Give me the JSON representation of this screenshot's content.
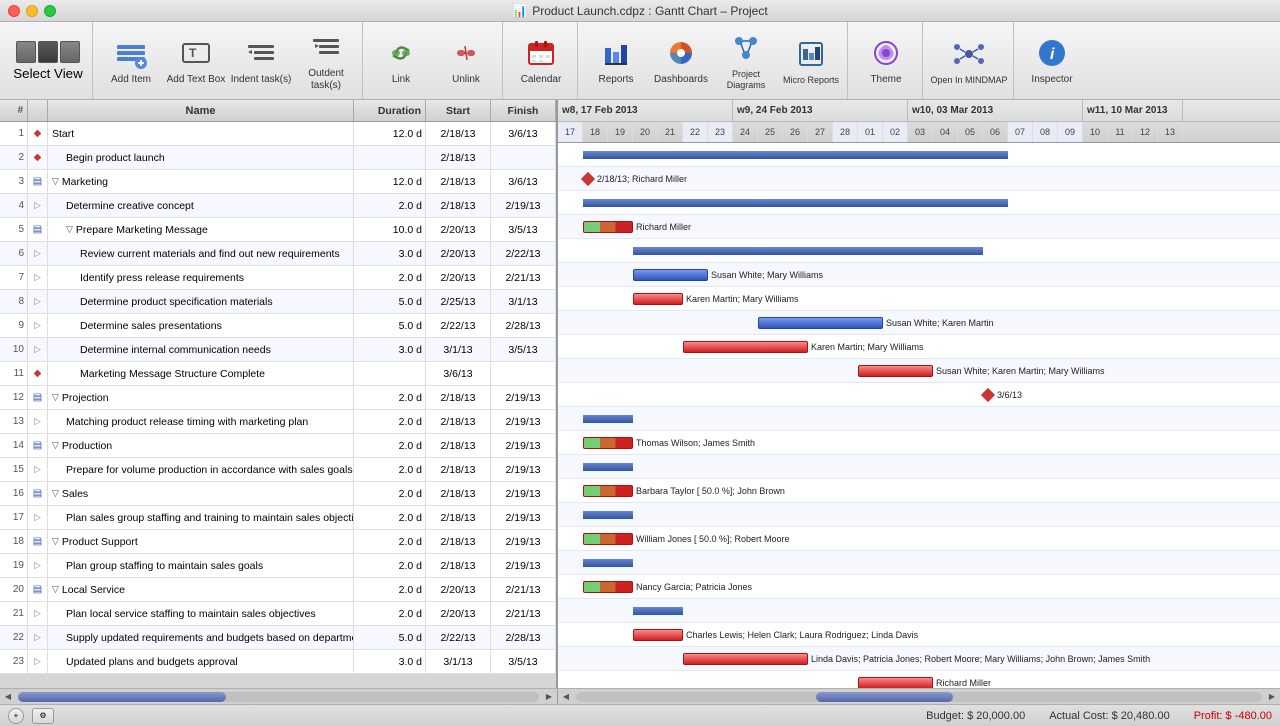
{
  "titlebar": {
    "title": "Product Launch.cdpz : Gantt Chart – Project"
  },
  "toolbar": {
    "select_view_label": "Select View",
    "add_item_label": "Add Item",
    "add_text_box_label": "Add Text Box",
    "indent_label": "Indent task(s)",
    "outdent_label": "Outdent task(s)",
    "link_label": "Link",
    "unlink_label": "Unlink",
    "calendar_label": "Calendar",
    "reports_label": "Reports",
    "dashboards_label": "Dashboards",
    "project_diagrams_label": "Project Diagrams",
    "micro_reports_label": "Micro Reports",
    "theme_label": "Theme",
    "open_in_mindmap_label": "Open In MINDMAP",
    "inspector_label": "Inspector"
  },
  "table": {
    "headers": [
      "#",
      "Name",
      "Duration",
      "Start",
      "Finish"
    ],
    "rows": [
      {
        "num": 1,
        "indent": 0,
        "name": "Start",
        "duration": "12.0 d",
        "start": "2/18/13",
        "finish": "3/6/13",
        "is_milestone": true
      },
      {
        "num": 2,
        "indent": 1,
        "name": "Begin product launch",
        "duration": "",
        "start": "2/18/13",
        "finish": "",
        "is_milestone": true
      },
      {
        "num": 3,
        "indent": 0,
        "name": "Marketing",
        "duration": "12.0 d",
        "start": "2/18/13",
        "finish": "3/6/13",
        "is_group": true
      },
      {
        "num": 4,
        "indent": 1,
        "name": "Determine creative concept",
        "duration": "2.0 d",
        "start": "2/18/13",
        "finish": "2/19/13"
      },
      {
        "num": 5,
        "indent": 1,
        "name": "Prepare Marketing Message",
        "duration": "10.0 d",
        "start": "2/20/13",
        "finish": "3/5/13",
        "is_group": true
      },
      {
        "num": 6,
        "indent": 2,
        "name": "Review current materials and find out new requirements",
        "duration": "3.0 d",
        "start": "2/20/13",
        "finish": "2/22/13"
      },
      {
        "num": 7,
        "indent": 2,
        "name": "Identify press release requirements",
        "duration": "2.0 d",
        "start": "2/20/13",
        "finish": "2/21/13"
      },
      {
        "num": 8,
        "indent": 2,
        "name": "Determine product specification materials",
        "duration": "5.0 d",
        "start": "2/25/13",
        "finish": "3/1/13"
      },
      {
        "num": 9,
        "indent": 2,
        "name": "Determine sales presentations",
        "duration": "5.0 d",
        "start": "2/22/13",
        "finish": "2/28/13"
      },
      {
        "num": 10,
        "indent": 2,
        "name": "Determine internal communication needs",
        "duration": "3.0 d",
        "start": "3/1/13",
        "finish": "3/5/13"
      },
      {
        "num": 11,
        "indent": 2,
        "name": "Marketing Message Structure Complete",
        "duration": "",
        "start": "3/6/13",
        "finish": "",
        "is_milestone": true
      },
      {
        "num": 12,
        "indent": 0,
        "name": "Projection",
        "duration": "2.0 d",
        "start": "2/18/13",
        "finish": "2/19/13",
        "is_group": true
      },
      {
        "num": 13,
        "indent": 1,
        "name": "Matching product release timing with marketing plan",
        "duration": "2.0 d",
        "start": "2/18/13",
        "finish": "2/19/13"
      },
      {
        "num": 14,
        "indent": 0,
        "name": "Production",
        "duration": "2.0 d",
        "start": "2/18/13",
        "finish": "2/19/13",
        "is_group": true
      },
      {
        "num": 15,
        "indent": 1,
        "name": "Prepare for volume production in accordance with sales goals",
        "duration": "2.0 d",
        "start": "2/18/13",
        "finish": "2/19/13"
      },
      {
        "num": 16,
        "indent": 0,
        "name": "Sales",
        "duration": "2.0 d",
        "start": "2/18/13",
        "finish": "2/19/13",
        "is_group": true
      },
      {
        "num": 17,
        "indent": 1,
        "name": "Plan sales group staffing and training to maintain sales objectives",
        "duration": "2.0 d",
        "start": "2/18/13",
        "finish": "2/19/13"
      },
      {
        "num": 18,
        "indent": 0,
        "name": "Product Support",
        "duration": "2.0 d",
        "start": "2/18/13",
        "finish": "2/19/13",
        "is_group": true
      },
      {
        "num": 19,
        "indent": 1,
        "name": "Plan group staffing to maintain sales goals",
        "duration": "2.0 d",
        "start": "2/18/13",
        "finish": "2/19/13"
      },
      {
        "num": 20,
        "indent": 0,
        "name": "Local Service",
        "duration": "2.0 d",
        "start": "2/20/13",
        "finish": "2/21/13",
        "is_group": true
      },
      {
        "num": 21,
        "indent": 1,
        "name": "Plan local service staffing to maintain sales objectives",
        "duration": "2.0 d",
        "start": "2/20/13",
        "finish": "2/21/13"
      },
      {
        "num": 22,
        "indent": 1,
        "name": "Supply updated requirements and budgets based on departmental plans",
        "duration": "5.0 d",
        "start": "2/22/13",
        "finish": "2/28/13"
      },
      {
        "num": 23,
        "indent": 1,
        "name": "Updated plans and budgets approval",
        "duration": "3.0 d",
        "start": "3/1/13",
        "finish": "3/5/13"
      }
    ]
  },
  "gantt": {
    "weeks": [
      {
        "label": "w8, 17 Feb 2013",
        "days": [
          "17",
          "18",
          "19",
          "20",
          "21",
          "22",
          "23"
        ]
      },
      {
        "label": "w9, 24 Feb 2013",
        "days": [
          "24",
          "25",
          "26",
          "27",
          "28",
          "01",
          "02"
        ]
      },
      {
        "label": "w10, 03 Mar 2013",
        "days": [
          "03",
          "04",
          "05",
          "06",
          "07",
          "08",
          "09"
        ]
      },
      {
        "label": "w11, 10 Mar 2013",
        "days": [
          "10",
          "11",
          "12",
          "13"
        ]
      }
    ]
  },
  "statusbar": {
    "budget_label": "Budget:",
    "budget_value": "$ 20,000.00",
    "actual_label": "Actual Cost:",
    "actual_value": "$ 20,480.00",
    "profit_label": "Profit:",
    "profit_value": "$ -480.00"
  }
}
